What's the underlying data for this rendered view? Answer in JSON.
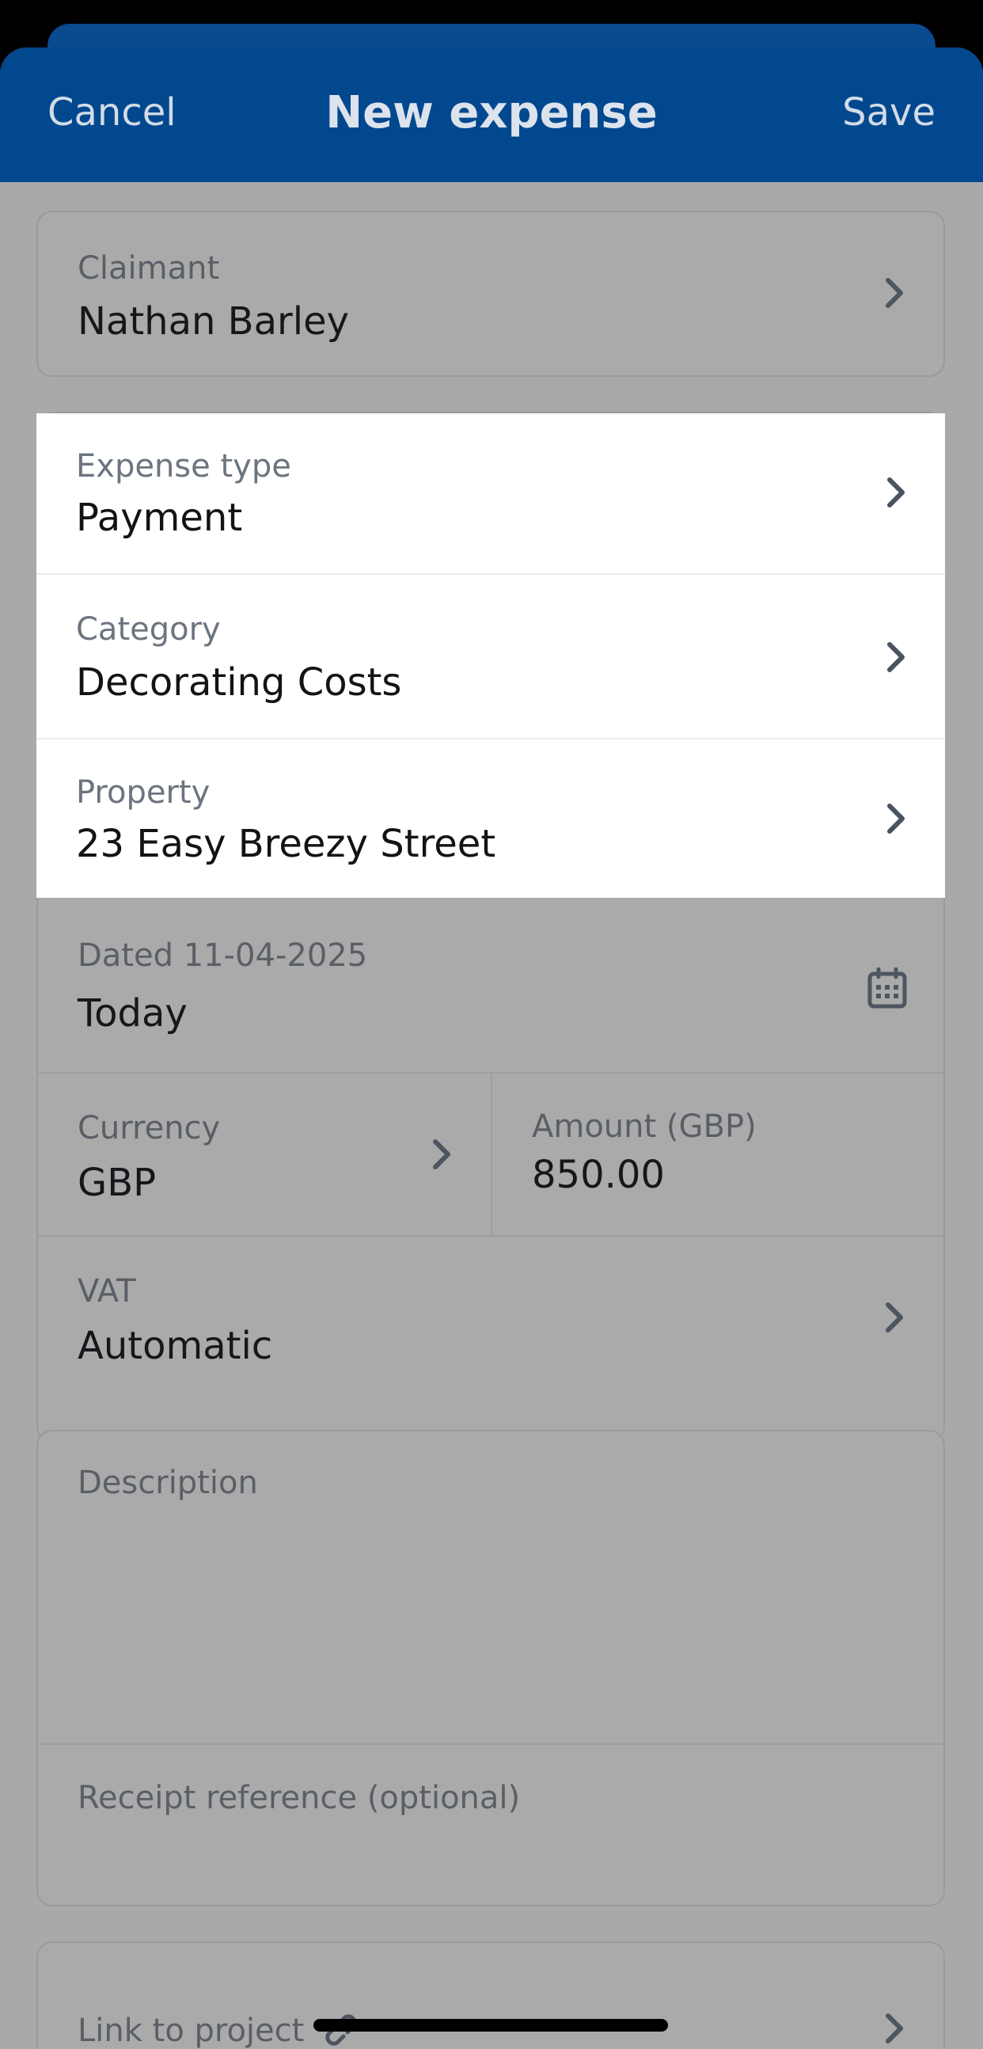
{
  "navbar": {
    "cancel_label": "Cancel",
    "title": "New expense",
    "save_label": "Save"
  },
  "claimant": {
    "label": "Claimant",
    "value": "Nathan Barley",
    "icon": "chevron-right-icon"
  },
  "expense_type": {
    "label": "Expense type",
    "value": "Payment"
  },
  "category": {
    "label": "Category",
    "value": "Decorating Costs"
  },
  "property": {
    "label": "Property",
    "value": "23 Easy Breezy Street"
  },
  "date": {
    "label": "Dated 11-04-2025",
    "value": "Today",
    "icon": "calendar-icon"
  },
  "currency": {
    "label": "Currency",
    "value": "GBP"
  },
  "amount": {
    "label": "Amount (GBP)",
    "value": "850.00"
  },
  "vat": {
    "label": "VAT",
    "value": "Automatic"
  },
  "description": {
    "label": "Description"
  },
  "receipt": {
    "label": "Receipt reference (optional)"
  },
  "link_project": {
    "label": "Link to project",
    "icon": "link-icon"
  },
  "colors": {
    "navbar": "#02488f",
    "dimmed_background": "#a9a9aa",
    "highlight": "#ffffff"
  }
}
